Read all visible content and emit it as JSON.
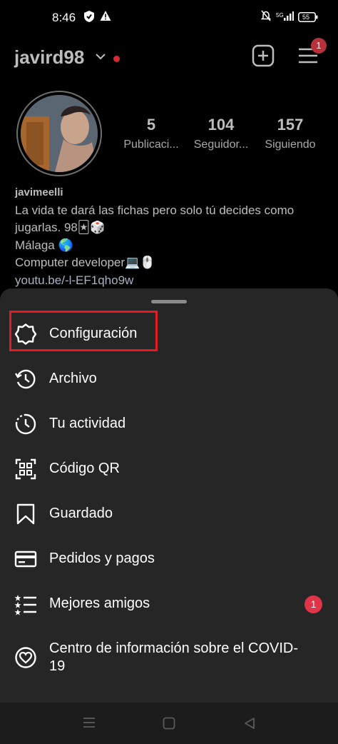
{
  "status_bar": {
    "time": "8:46",
    "network": "5G",
    "battery": "55",
    "icons": [
      "shield-icon",
      "warning-icon",
      "mute-icon",
      "signal-icon",
      "battery-icon"
    ]
  },
  "header": {
    "username": "javird98",
    "icons": [
      "chevron-down-icon",
      "add-post-icon",
      "hamburger-menu-icon"
    ],
    "menu_badge": "1"
  },
  "stats": [
    {
      "value": "5",
      "label": "Publicaci..."
    },
    {
      "value": "104",
      "label": "Seguidor..."
    },
    {
      "value": "157",
      "label": "Siguiendo"
    }
  ],
  "bio": {
    "name": "javimeelli",
    "line1": "La vida te dará las fichas pero solo tú decides como",
    "line2": "jugarlas. 98🃏🎲",
    "line3": "Málaga 🌎",
    "line4": "Computer developer💻🖱️",
    "link": "youtu.be/-l-EF1qho9w"
  },
  "menu": {
    "items": [
      {
        "label": "Configuración",
        "icon": "settings-icon"
      },
      {
        "label": "Archivo",
        "icon": "archive-history-icon"
      },
      {
        "label": "Tu actividad",
        "icon": "activity-clock-icon"
      },
      {
        "label": "Código QR",
        "icon": "qr-code-icon"
      },
      {
        "label": "Guardado",
        "icon": "bookmark-icon"
      },
      {
        "label": "Pedidos y pagos",
        "icon": "credit-card-icon"
      },
      {
        "label": "Mejores amigos",
        "icon": "close-friends-list-icon",
        "badge": "1"
      },
      {
        "label": "Centro de información sobre el COVID-19",
        "icon": "covid-info-heart-icon"
      }
    ]
  },
  "colors": {
    "sheet": "#262626",
    "highlight": "#e51c23",
    "badge": "#e03549"
  },
  "nav_bar": {
    "icons": [
      "recent-apps-icon",
      "home-icon",
      "back-icon"
    ]
  }
}
